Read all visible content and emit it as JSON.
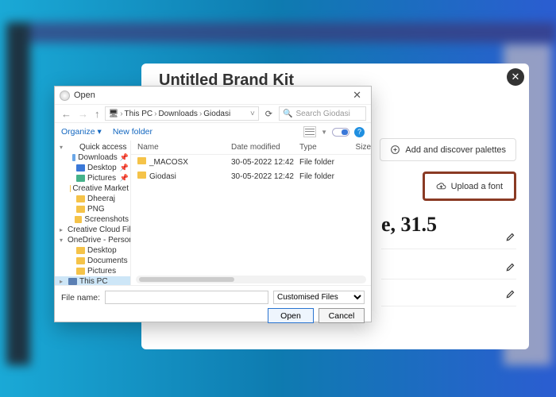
{
  "background_modal": {
    "title": "Untitled Brand Kit",
    "palettes_button": "Add and discover palettes",
    "upload_button": "Upload a font",
    "heading_sample": "e, 31.5"
  },
  "file_dialog": {
    "title": "Open",
    "breadcrumb": [
      "This PC",
      "Downloads",
      "Giodasi"
    ],
    "search_placeholder": "Search Giodasi",
    "toolbar": {
      "organize": "Organize",
      "new_folder": "New folder"
    },
    "tree": [
      {
        "label": "Quick access",
        "icon": "star",
        "caret": "▾"
      },
      {
        "label": "Downloads",
        "icon": "dl",
        "indent": 1,
        "pin": true
      },
      {
        "label": "Desktop",
        "icon": "desk",
        "indent": 1,
        "pin": true
      },
      {
        "label": "Pictures",
        "icon": "pic",
        "indent": 1,
        "pin": true
      },
      {
        "label": "Creative Market",
        "icon": "folder",
        "indent": 1
      },
      {
        "label": "Dheeraj",
        "icon": "folder",
        "indent": 1
      },
      {
        "label": "PNG",
        "icon": "folder",
        "indent": 1
      },
      {
        "label": "Screenshots",
        "icon": "folder",
        "indent": 1
      },
      {
        "label": "Creative Cloud Fil…",
        "icon": "folder",
        "caret": "▸"
      },
      {
        "label": "OneDrive - Person",
        "icon": "od",
        "caret": "▾"
      },
      {
        "label": "Desktop",
        "icon": "folder",
        "indent": 1
      },
      {
        "label": "Documents",
        "icon": "folder",
        "indent": 1
      },
      {
        "label": "Pictures",
        "icon": "folder",
        "indent": 1
      },
      {
        "label": "This PC",
        "icon": "pc",
        "caret": "▸",
        "selected": true
      }
    ],
    "columns": {
      "name": "Name",
      "date": "Date modified",
      "type": "Type",
      "size": "Size"
    },
    "rows": [
      {
        "name": "_MACOSX",
        "date": "30-05-2022 12:42",
        "type": "File folder",
        "size": ""
      },
      {
        "name": "Giodasi",
        "date": "30-05-2022 12:42",
        "type": "File folder",
        "size": ""
      }
    ],
    "footer": {
      "filename_label": "File name:",
      "filename_value": "",
      "filter": "Customised Files",
      "open": "Open",
      "cancel": "Cancel"
    }
  }
}
